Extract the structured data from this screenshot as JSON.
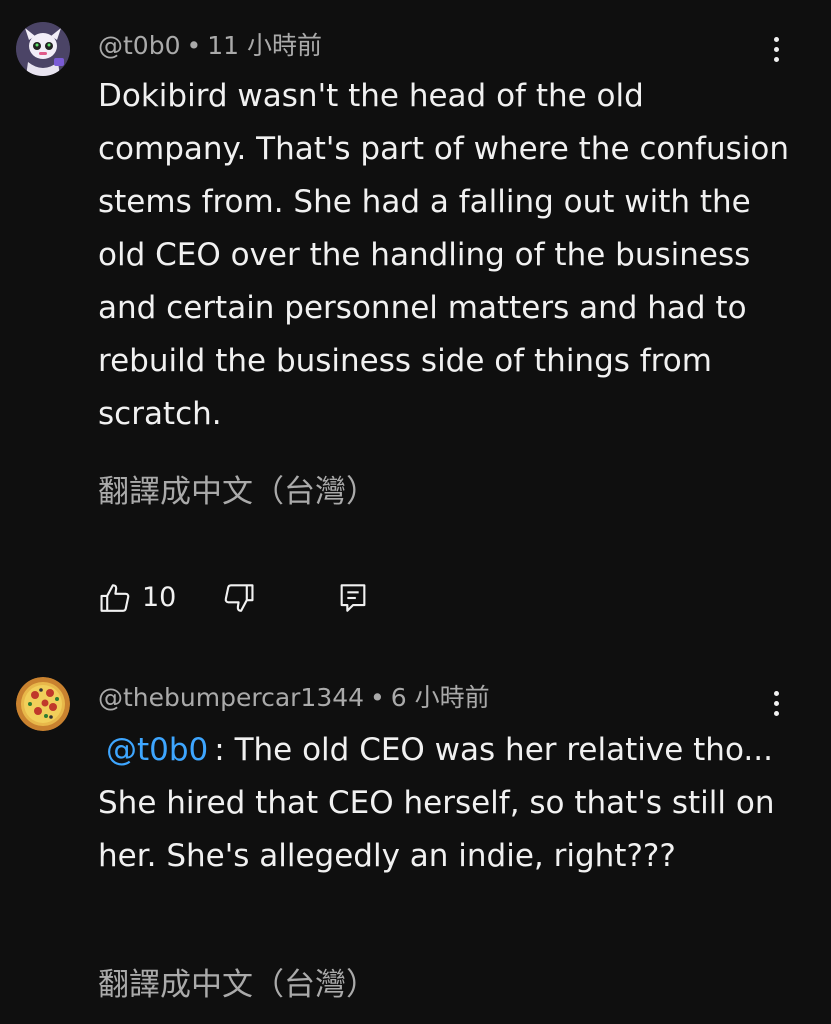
{
  "comments": [
    {
      "handle": "@t0b0",
      "time": "11 小時前",
      "text": "Dokibird wasn't the head of the old company. That's part of where the confusion stems from. She had a falling out with the old CEO over the handling of the business and certain personnel matters and had to rebuild the business side of things from scratch.",
      "translate_label": "翻譯成中文（台灣）",
      "like_count": "10",
      "avatar_icon": "robot-avatar-icon"
    },
    {
      "handle": "@thebumpercar1344",
      "time": "6 小時前",
      "mention": "@t0b0",
      "text": ": The old CEO was her relative tho... She hired that CEO herself, so that's still on her. She's allegedly an indie, right???",
      "translate_label": "翻譯成中文（台灣）",
      "avatar_icon": "pizza-avatar-icon"
    }
  ],
  "separator": "•",
  "colors": {
    "background": "#0f0f0f",
    "primary_text": "#f1f1f1",
    "secondary_text": "#aaaaaa",
    "mention": "#3ea6ff"
  }
}
